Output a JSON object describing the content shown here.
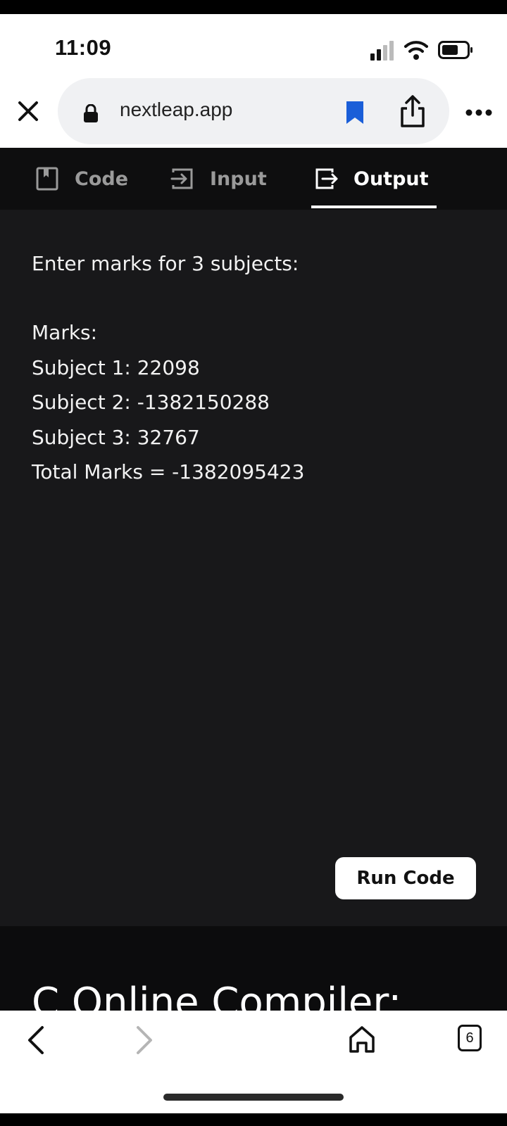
{
  "status_bar": {
    "time": "11:09"
  },
  "browser": {
    "url": "nextleap.app"
  },
  "tabs": [
    {
      "label": "Code",
      "icon": "book-icon",
      "active": false
    },
    {
      "label": "Input",
      "icon": "input-arrow-icon",
      "active": false
    },
    {
      "label": "Output",
      "icon": "output-arrow-icon",
      "active": true
    }
  ],
  "output": {
    "lines": [
      "Enter marks for 3 subjects:",
      "Marks:",
      "Subject 1: 22098",
      "Subject 2: -1382150288",
      "Subject 3: 32767",
      "Total Marks = -1382095423"
    ]
  },
  "run_button": {
    "label": "Run Code"
  },
  "section": {
    "heading": "C Online Compiler:"
  },
  "toolbar": {
    "tab_count": "6"
  },
  "colors": {
    "bookmark": "#1a5ed8",
    "panel_bg": "#18181a",
    "tab_bar_bg": "#0e0e0f"
  }
}
